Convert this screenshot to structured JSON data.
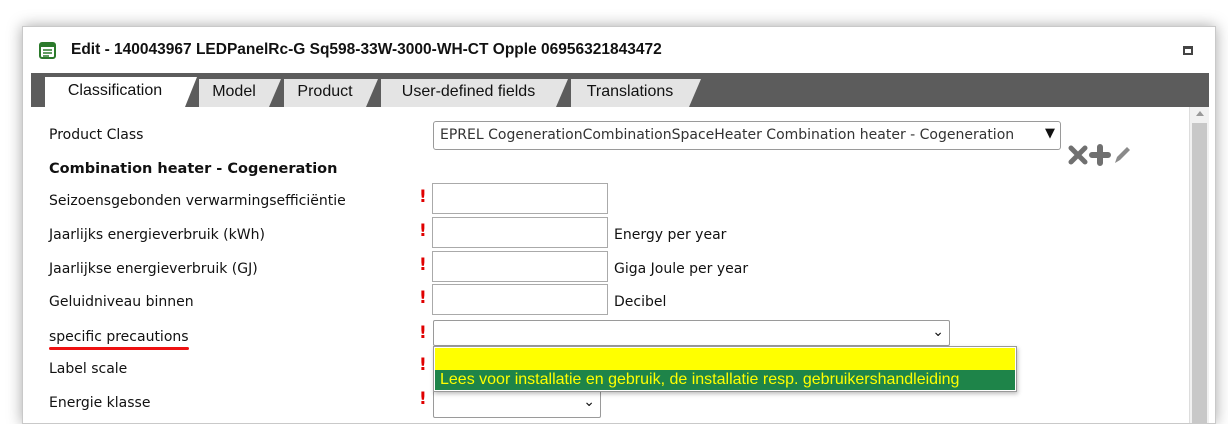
{
  "window": {
    "title": "Edit - 140043967 LEDPanelRc-G Sq598-33W-3000-WH-CT Opple 06956321843472"
  },
  "tabs": [
    {
      "label": "Classification",
      "active": true
    },
    {
      "label": "Model",
      "active": false
    },
    {
      "label": "Product",
      "active": false
    },
    {
      "label": "User-defined fields",
      "active": false
    },
    {
      "label": "Translations",
      "active": false
    }
  ],
  "product_class": {
    "label": "Product Class",
    "value": "EPREL CogenerationCombinationSpaceHeater Combination heater - Cogeneration"
  },
  "section": {
    "title": "Combination heater - Cogeneration"
  },
  "fields": [
    {
      "label": "Seizoensgebonden verwarmingsefficiëntie",
      "required": "!",
      "unit": ""
    },
    {
      "label": "Jaarlijks energieverbruik (kWh)",
      "required": "!",
      "unit": "Energy per year"
    },
    {
      "label": "Jaarlijkse energieverbruik (GJ)",
      "required": "!",
      "unit": "Giga Joule per year"
    },
    {
      "label": "Geluidniveau binnen",
      "required": "!",
      "unit": "Decibel"
    },
    {
      "label": "specific precautions",
      "required": "!",
      "unit": ""
    },
    {
      "label": "Label scale",
      "required": "!",
      "unit": ""
    },
    {
      "label": "Energie klasse",
      "required": "!",
      "unit": ""
    }
  ],
  "dropdown": {
    "options": [
      "",
      "Lees voor installatie en gebruik, de installatie resp. gebruikershandleiding"
    ],
    "highlight_color": "#ffff00",
    "selected_bg": "#1e8449"
  },
  "icons": {
    "window": "form-icon",
    "clear": "clear-x-icon",
    "add": "plus-icon",
    "edit": "pencil-icon",
    "maximize": "maximize-icon"
  },
  "colors": {
    "tabstrip": "#5c5c5c",
    "required": "#e00000",
    "annotation_underline": "#e11111"
  }
}
